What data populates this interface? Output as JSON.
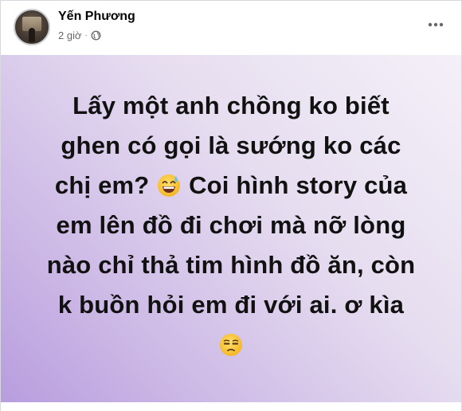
{
  "post": {
    "author": "Yến Phương",
    "timestamp": "2 giờ",
    "separator": "·",
    "privacy_icon": "globe-icon",
    "more_icon": "more-options-icon",
    "text_lines": [
      "Lấy một anh chồng ko biết",
      "ghen có gọi là sướng ko các",
      "chị em?",
      "Coi hình story của",
      "em lên đồ đi chơi mà nỡ lòng",
      "nào chỉ thả tim hình đồ ăn, còn",
      "k buồn hỏi em đi với ai. ơ kìa"
    ],
    "emojis": [
      "grinning-sweat-emoji",
      "unamused-emoji"
    ],
    "background_colors": [
      "#f4f0f8",
      "#b89dde"
    ]
  }
}
